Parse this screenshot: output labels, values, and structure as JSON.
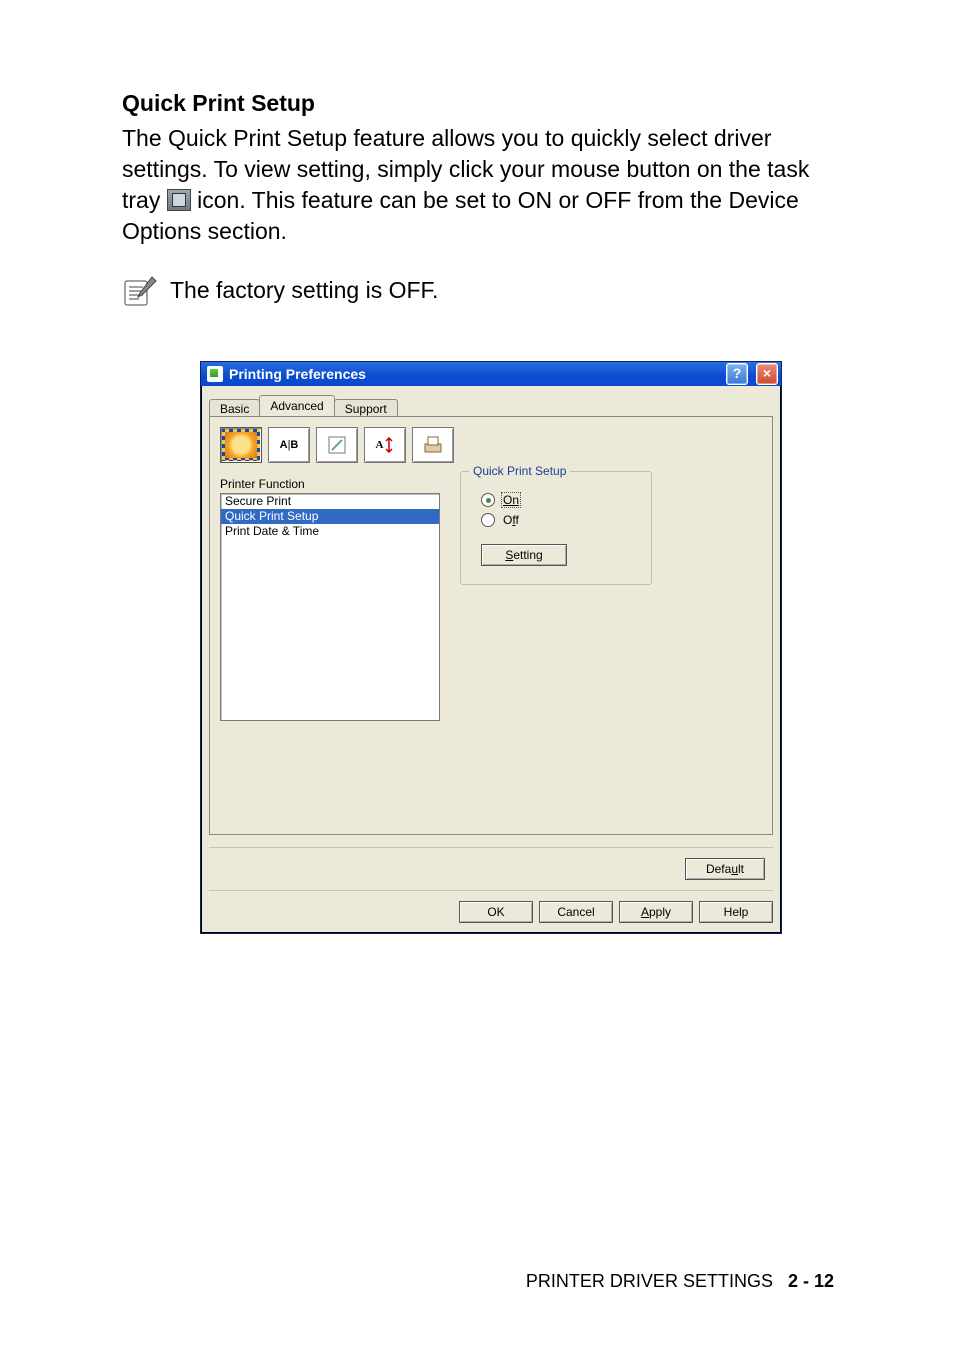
{
  "doc": {
    "heading": "Quick Print Setup",
    "para_before_icon": "The Quick Print Setup feature allows you to quickly select driver settings. To view setting, simply click your mouse button on the task tray ",
    "para_after_icon": " icon. This feature can be set to ON or OFF from the Device Options section.",
    "note": "The factory setting is OFF."
  },
  "dialog": {
    "title": "Printing Preferences",
    "tabs": {
      "basic": "Basic",
      "advanced": "Advanced",
      "support": "Support"
    },
    "active_tab": "Advanced",
    "toolbar_icons": [
      "pattern",
      "AB",
      "sheet",
      "Av",
      "printer"
    ],
    "printer_function_label": "Printer Function",
    "function_list": [
      "Secure Print",
      "Quick Print Setup",
      "Print Date & Time"
    ],
    "function_selected_index": 1,
    "group": {
      "title": "Quick Print Setup",
      "on_label": "On",
      "off_label": "Off",
      "selected": "on",
      "setting_button": "Setting"
    },
    "default_button": "Default",
    "buttons": {
      "ok": "OK",
      "cancel": "Cancel",
      "apply": "Apply",
      "help": "Help"
    }
  },
  "footer": {
    "section": "PRINTER DRIVER SETTINGS",
    "page": "2 - 12"
  }
}
